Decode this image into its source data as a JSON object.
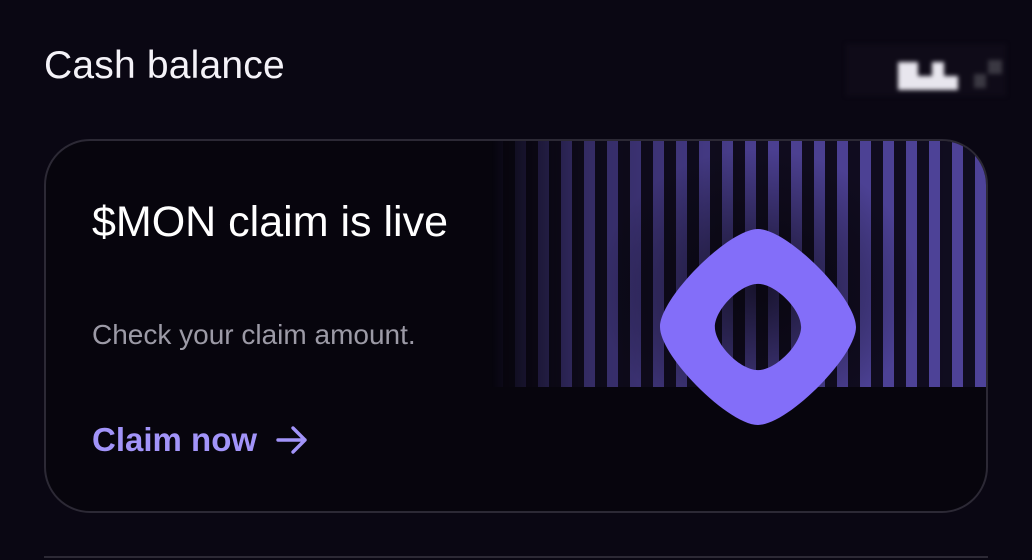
{
  "header": {
    "title": "Cash balance",
    "balance_icon": "obscured-balance-icon"
  },
  "promo_card": {
    "headline": "$MON claim is live",
    "subtext": "Check your claim amount.",
    "cta_label": "Claim now",
    "cta_icon": "arrow-right-icon",
    "logo_icon": "monad-logo-icon",
    "accent_color": "#836ef9",
    "cta_color": "#a294f9"
  }
}
